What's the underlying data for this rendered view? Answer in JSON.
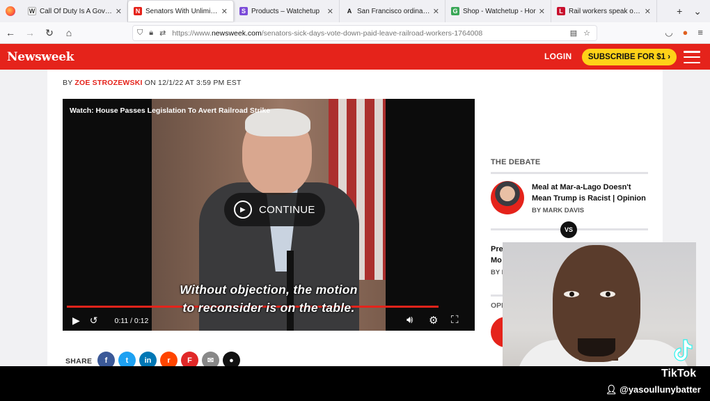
{
  "browser": {
    "tabs": [
      {
        "favicon": "W",
        "favicon_color": "#ffffff",
        "title": "Call Of Duty Is A Governi"
      },
      {
        "favicon": "N",
        "favicon_color": "#e5231b",
        "title": "Senators With Unlimited",
        "active": true
      },
      {
        "favicon": "S",
        "favicon_color": "#7b4bd8",
        "title": "Products – Watchetup"
      },
      {
        "favicon": "A",
        "favicon_color": "#ffffff",
        "title": "San Francisco ordinance"
      },
      {
        "favicon": "G",
        "favicon_color": "#3aa757",
        "title": "Shop - Watchetup - Hor"
      },
      {
        "favicon": "L",
        "favicon_color": "#c8102e",
        "title": "Rail workers speak out a"
      }
    ],
    "new_tab_icon": "plus-icon",
    "url_prefix": "https://www.",
    "url_domain": "newsweek.com",
    "url_path": "/senators-sick-days-vote-down-paid-leave-railroad-workers-1764008"
  },
  "site": {
    "logo": "Newsweek",
    "login": "LOGIN",
    "subscribe": "SUBSCRIBE FOR $1 ›",
    "brand_color": "#e5231b",
    "subscribe_color": "#ffd218"
  },
  "article": {
    "byline_prefix": "BY",
    "author": "ZOE STROZEWSKI",
    "byline_suffix": "ON 12/1/22 AT 3:59 PM EST"
  },
  "video": {
    "title": "Watch: House Passes Legislation To Avert Railroad Strike",
    "continue_label": "CONTINUE",
    "caption_line1": "Without objection, the motion",
    "caption_line2": "to reconsider is on the table.",
    "time": "0:11 / 0:12",
    "progress_fraction": 0.92
  },
  "share": {
    "label": "SHARE",
    "buttons": [
      {
        "name": "facebook",
        "glyph": "f",
        "color": "#3b5998"
      },
      {
        "name": "twitter",
        "glyph": "t",
        "color": "#1da1f2"
      },
      {
        "name": "linkedin",
        "glyph": "in",
        "color": "#0077b5"
      },
      {
        "name": "reddit",
        "glyph": "r",
        "color": "#ff4500"
      },
      {
        "name": "flipboard",
        "glyph": "F",
        "color": "#e12828"
      },
      {
        "name": "email",
        "glyph": "✉",
        "color": "#888888"
      },
      {
        "name": "comment",
        "glyph": "●",
        "color": "#111111"
      }
    ]
  },
  "sidebar": {
    "debate_label": "THE DEBATE",
    "debate_title": "Meal at Mar-a-Lago Doesn't Mean Trump is Racist | Opinion",
    "debate_by": "BY MARK DAVIS",
    "vs": "VS",
    "second_title_l1": "Pre",
    "second_title_l2": "Mo",
    "second_by": "BY E",
    "opinion_label": "OPI"
  },
  "overlay": {
    "tiktok": "TikTok",
    "handle": "@yasoullunybatter"
  }
}
